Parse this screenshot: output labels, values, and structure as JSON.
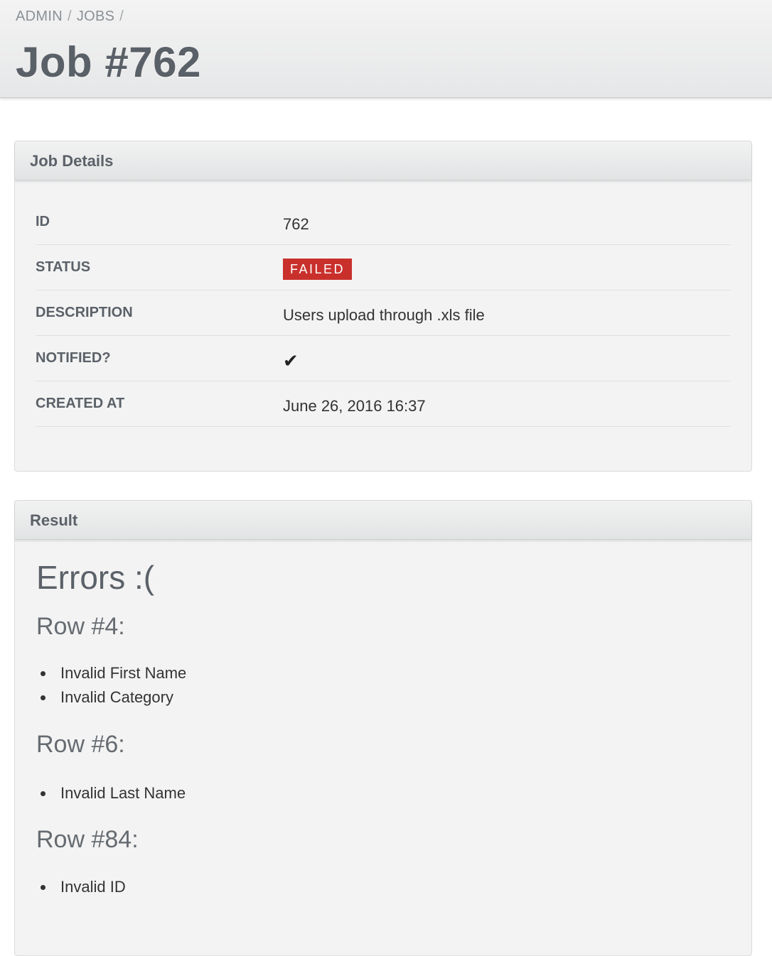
{
  "breadcrumb": {
    "items": [
      "ADMIN",
      "JOBS"
    ],
    "separator": "/"
  },
  "page": {
    "title": "Job #762"
  },
  "details_panel": {
    "heading": "Job Details",
    "rows": [
      {
        "label": "ID",
        "value": "762"
      },
      {
        "label": "STATUS",
        "value": "FAILED",
        "status_color": "#c9302c"
      },
      {
        "label": "DESCRIPTION",
        "value": "Users upload through .xls file"
      },
      {
        "label": "NOTIFIED?",
        "value": "✔",
        "icon": "checkmark-icon"
      },
      {
        "label": "CREATED AT",
        "value": "June 26, 2016 16:37"
      }
    ]
  },
  "result_panel": {
    "heading": "Result",
    "errors_title": "Errors :(",
    "groups": [
      {
        "title": "Row #4:",
        "errors": [
          "Invalid First Name",
          "Invalid Category"
        ]
      },
      {
        "title": "Row #6:",
        "errors": [
          "Invalid Last Name"
        ]
      },
      {
        "title": "Row #84:",
        "errors": [
          "Invalid ID"
        ]
      }
    ]
  }
}
